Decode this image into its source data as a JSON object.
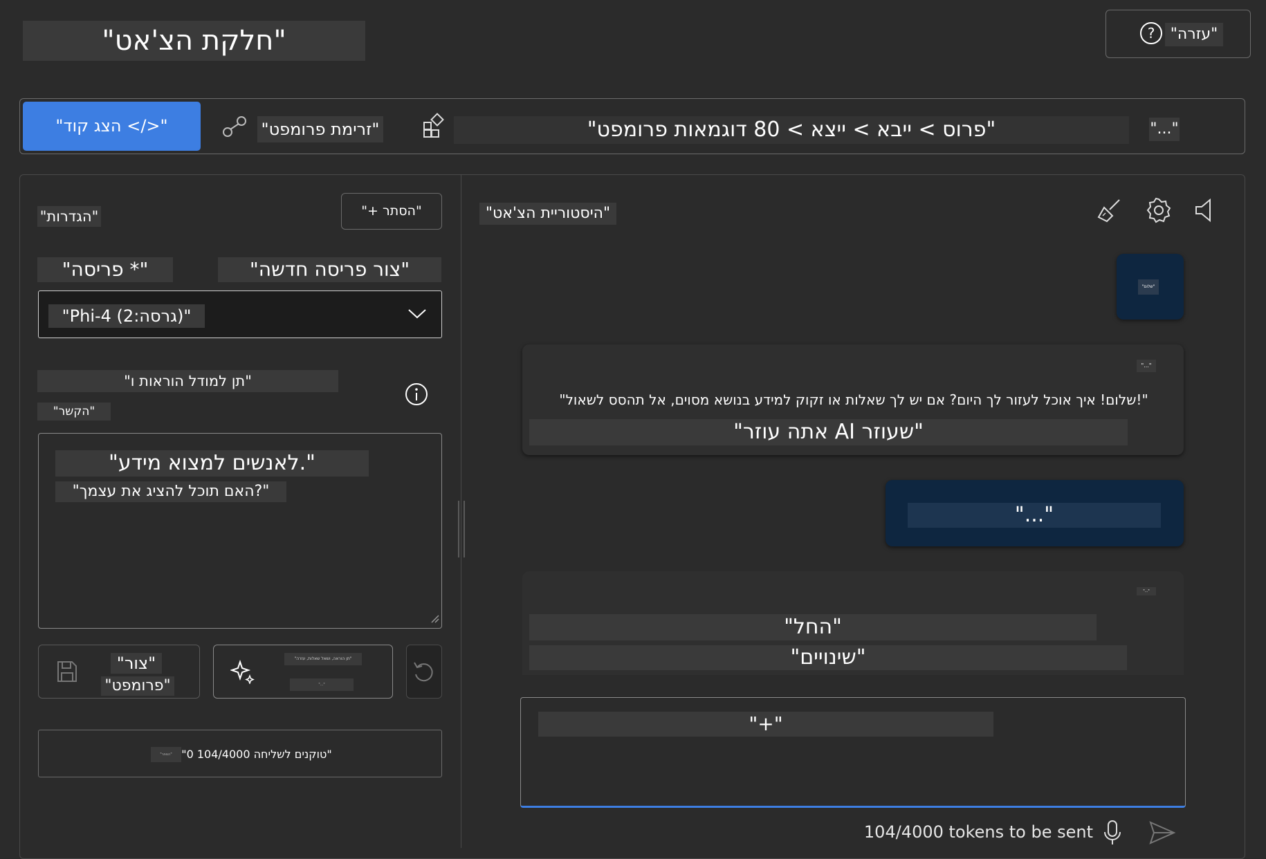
{
  "header": {
    "title": "\"חלקת הצ'אט\"",
    "help_label": "\"עזרה\""
  },
  "toolbar": {
    "view_code": "\"הצג קוד </>\"",
    "prompt_flow": "\"זרימת פרומפט\"",
    "breadcrumb": "\"פרוס > ייבא > ייצא > 80 דוגמאות פרומפט\"",
    "more": "\"...\""
  },
  "settings": {
    "title": "\"הגדרות\"",
    "hide_label": "\"+ הסתר\"",
    "persona_label": "\"פריסה *\"",
    "new_persona": "\"צור פריסה חדשה\"",
    "model_value": "\"Phi-4 (2:גרסה)\"",
    "instructions_label": "\"תן למודל הוראות ו\"",
    "context_label": "\"הקשר\"",
    "system_line1": "\"לאנשים למצוא מידע.\"",
    "system_line2": "\"האם תוכל להציג את עצמך?\"",
    "save_label_1": "\"צור\"",
    "save_label_2": "\"פרומפט\"",
    "improve_label_1": "\"תן הוראה, ושאל שאלות, עזרה\"",
    "improve_label_2": "\"...\"",
    "token_badge": "\"הסתר\"",
    "token_text": "\"0 טוקנים לשליחה 104/4000\""
  },
  "chat": {
    "title": "\"היסטוריית הצ'אט\"",
    "user_message_1": "\"שלום\"",
    "assistant_1_dots": "\"...\"",
    "assistant_1_line1": "\"שלום! איך אוכל לעזור לך היום? אם יש לך שאלות או זקוק למידע בנושא מסוים, אל תהסס לשאול!\"",
    "assistant_1_line2": "\"אתה עוזר AI שעוזר\"",
    "user_message_2": "\"...\"",
    "assistant_2_dots": "\"...\"",
    "assistant_2_line1": "\"החל\"",
    "assistant_2_line2": "\"שינויים\"",
    "input_value": "\"+\"",
    "token_status": "104/4000 tokens to be sent"
  },
  "icons": {
    "help": "question-circle-icon",
    "prompt_flow": "flow-link-icon",
    "gallery": "apps-grid-icon",
    "chevron": "chevron-down-icon",
    "info": "info-circle-icon",
    "save": "save-icon",
    "sparkle": "sparkle-icon",
    "undo": "undo-icon",
    "clear": "broom-icon",
    "settings": "gear-icon",
    "speaker": "speaker-icon",
    "mic": "microphone-icon",
    "send": "send-icon"
  },
  "colors": {
    "background": "#2b2b2b",
    "accent": "#3d7ee2",
    "user_bubble": "#0e2640",
    "assistant_bubble": "#2f2f2f"
  }
}
